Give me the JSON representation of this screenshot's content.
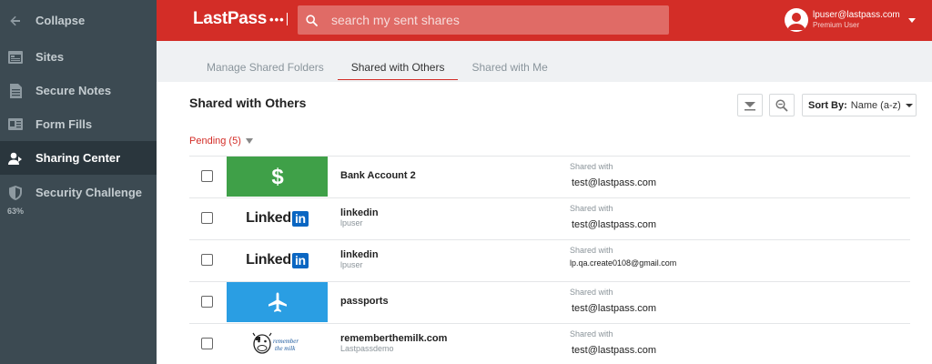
{
  "sidebar": {
    "collapse": "Collapse",
    "items": [
      {
        "label": "Sites"
      },
      {
        "label": "Secure Notes"
      },
      {
        "label": "Form Fills"
      },
      {
        "label": "Sharing Center"
      },
      {
        "label": "Security Challenge"
      }
    ],
    "security_score": "63%"
  },
  "header": {
    "logo": "LastPass",
    "logo_dots": "•••",
    "search_placeholder": "search my sent shares",
    "user_email": "lpuser@lastpass.com",
    "user_plan": "Premium User"
  },
  "tabs": [
    {
      "label": "Manage Shared Folders"
    },
    {
      "label": "Shared with Others"
    },
    {
      "label": "Shared with Me"
    }
  ],
  "main": {
    "title": "Shared with Others",
    "sort_label": "Sort By:",
    "sort_value": "Name (a-z)",
    "pending": "Pending (5)"
  },
  "rows": [
    {
      "name": "Bank Account 2",
      "sub": "",
      "shared_label": "Shared with",
      "shared_with": "test@lastpass.com",
      "thumb": "dollar-icon",
      "thumb_bg": "#3fa048"
    },
    {
      "name": "linkedin",
      "sub": "lpuser",
      "shared_label": "Shared with",
      "shared_with": "test@lastpass.com",
      "thumb": "linkedin-logo",
      "thumb_bg": "#ffffff"
    },
    {
      "name": "linkedin",
      "sub": "lpuser",
      "shared_label": "Shared with",
      "shared_with": "lp.qa.create0108@gmail.com",
      "thumb": "linkedin-logo",
      "thumb_bg": "#ffffff"
    },
    {
      "name": "passports",
      "sub": "",
      "shared_label": "Shared with",
      "shared_with": "test@lastpass.com",
      "thumb": "airplane-icon",
      "thumb_bg": "#2a9ee3"
    },
    {
      "name": "rememberthemilk.com",
      "sub": "Lastpassdemo",
      "shared_label": "Shared with",
      "shared_with": "test@lastpass.com",
      "thumb": "rememberthemilk-logo",
      "thumb_bg": "#ffffff"
    }
  ],
  "logos": {
    "linkedin_text": "Linked",
    "linkedin_in": "in",
    "rtm_line1": "remember",
    "rtm_line2": "the milk"
  },
  "colors": {
    "brand_red": "#d32d27",
    "sidebar": "#3c4a52",
    "sidebar_active": "#2a363d"
  }
}
